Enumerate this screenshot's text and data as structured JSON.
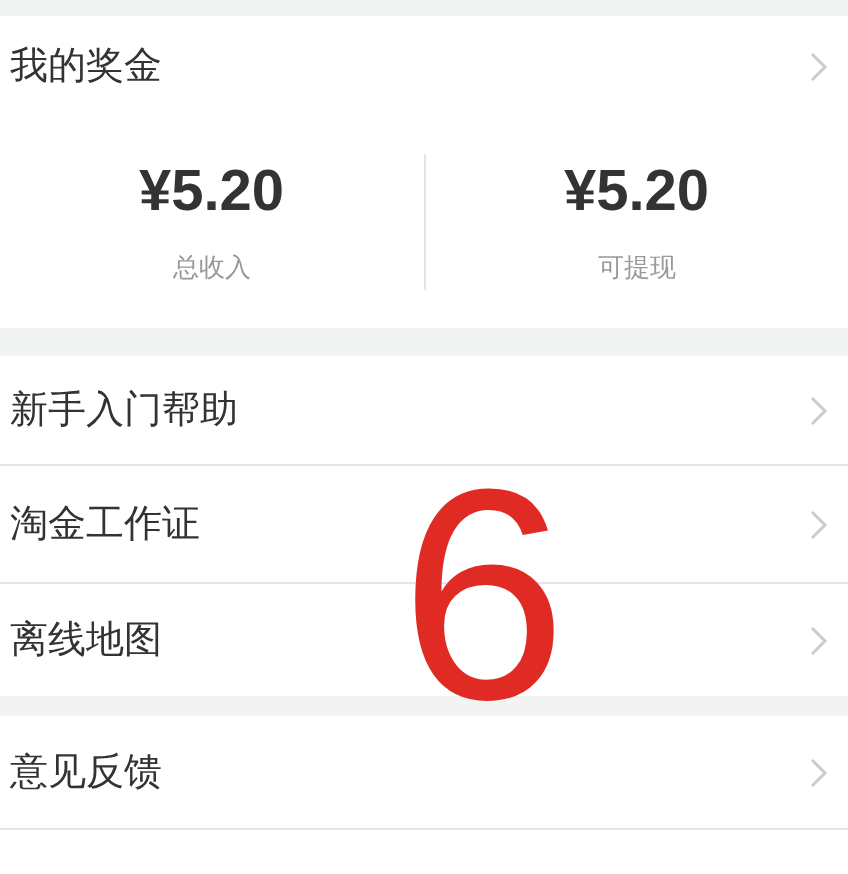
{
  "bonus": {
    "title": "我的奖金",
    "stats": [
      {
        "value": "¥5.20",
        "label": "总收入"
      },
      {
        "value": "¥5.20",
        "label": "可提现"
      }
    ]
  },
  "menu_groups": [
    [
      {
        "label": "新手入门帮助"
      },
      {
        "label": "淘金工作证"
      },
      {
        "label": "离线地图"
      }
    ],
    [
      {
        "label": "意见反馈"
      }
    ]
  ],
  "annotation": "6"
}
